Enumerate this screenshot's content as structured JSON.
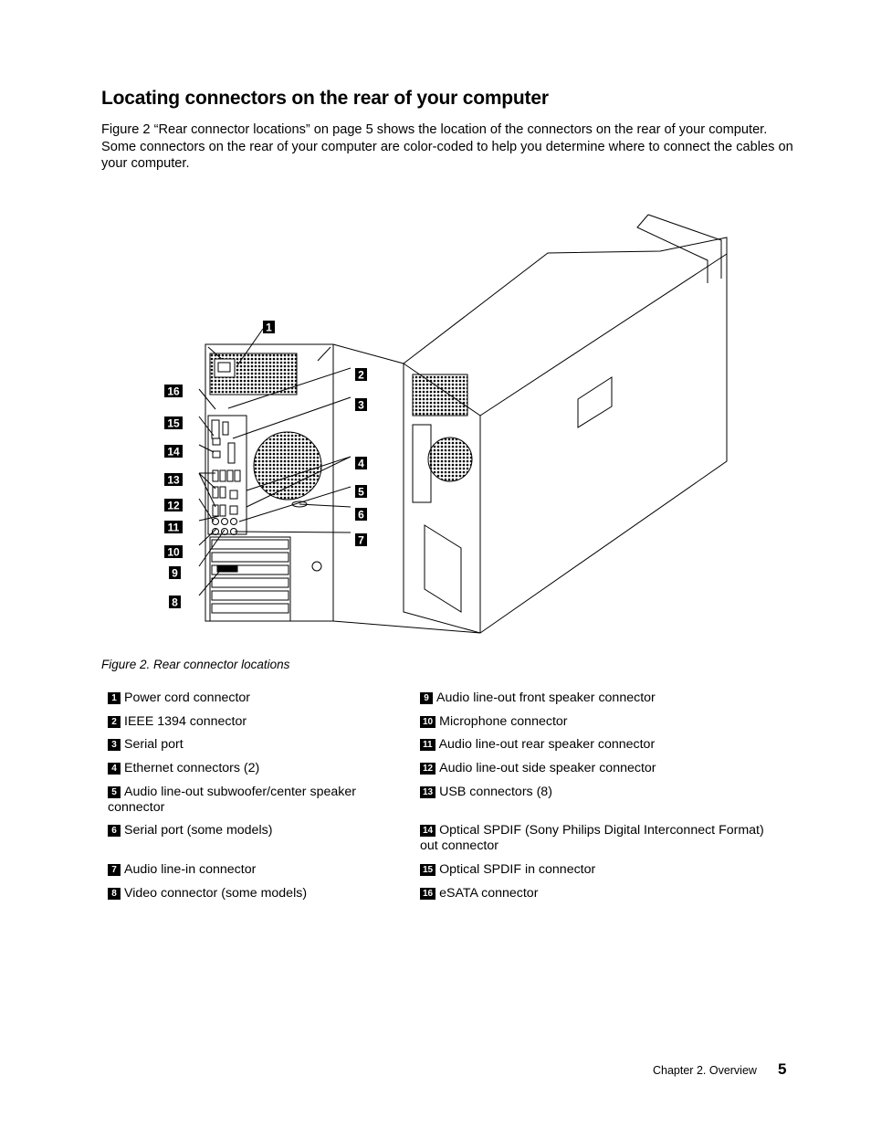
{
  "page": {
    "title": "Locating connectors on the rear of your computer",
    "intro": "Figure 2 “Rear connector locations” on page 5 shows the location of the connectors on the rear of your computer. Some connectors on the rear of your computer are color-coded to help you determine where to connect the cables on your computer.",
    "figure_caption": "Figure 2.  Rear connector locations",
    "figure_callouts": [
      "1",
      "2",
      "3",
      "4",
      "5",
      "6",
      "7",
      "8",
      "9",
      "10",
      "11",
      "12",
      "13",
      "14",
      "15",
      "16"
    ],
    "legend_left": [
      {
        "num": "1",
        "text": "Power cord connector"
      },
      {
        "num": "2",
        "text": "IEEE 1394 connector"
      },
      {
        "num": "3",
        "text": "Serial port"
      },
      {
        "num": "4",
        "text": "Ethernet connectors (2)"
      },
      {
        "num": "5",
        "text": "Audio line-out subwoofer/center speaker connector"
      },
      {
        "num": "6",
        "text": "Serial port (some models)"
      },
      {
        "num": "7",
        "text": "Audio line-in connector"
      },
      {
        "num": "8",
        "text": "Video connector (some models)"
      }
    ],
    "legend_right": [
      {
        "num": "9",
        "text": "Audio line-out front speaker connector"
      },
      {
        "num": "10",
        "text": "Microphone connector"
      },
      {
        "num": "11",
        "text": "Audio line-out rear speaker connector"
      },
      {
        "num": "12",
        "text": "Audio line-out side speaker connector"
      },
      {
        "num": "13",
        "text": "USB connectors (8)"
      },
      {
        "num": "14",
        "text": "Optical SPDIF (Sony Philips Digital Interconnect Format) out connector"
      },
      {
        "num": "15",
        "text": "Optical SPDIF in connector"
      },
      {
        "num": "16",
        "text": "eSATA connector"
      }
    ],
    "footer": {
      "chapter": "Chapter 2.  Overview",
      "page_number": "5"
    }
  }
}
